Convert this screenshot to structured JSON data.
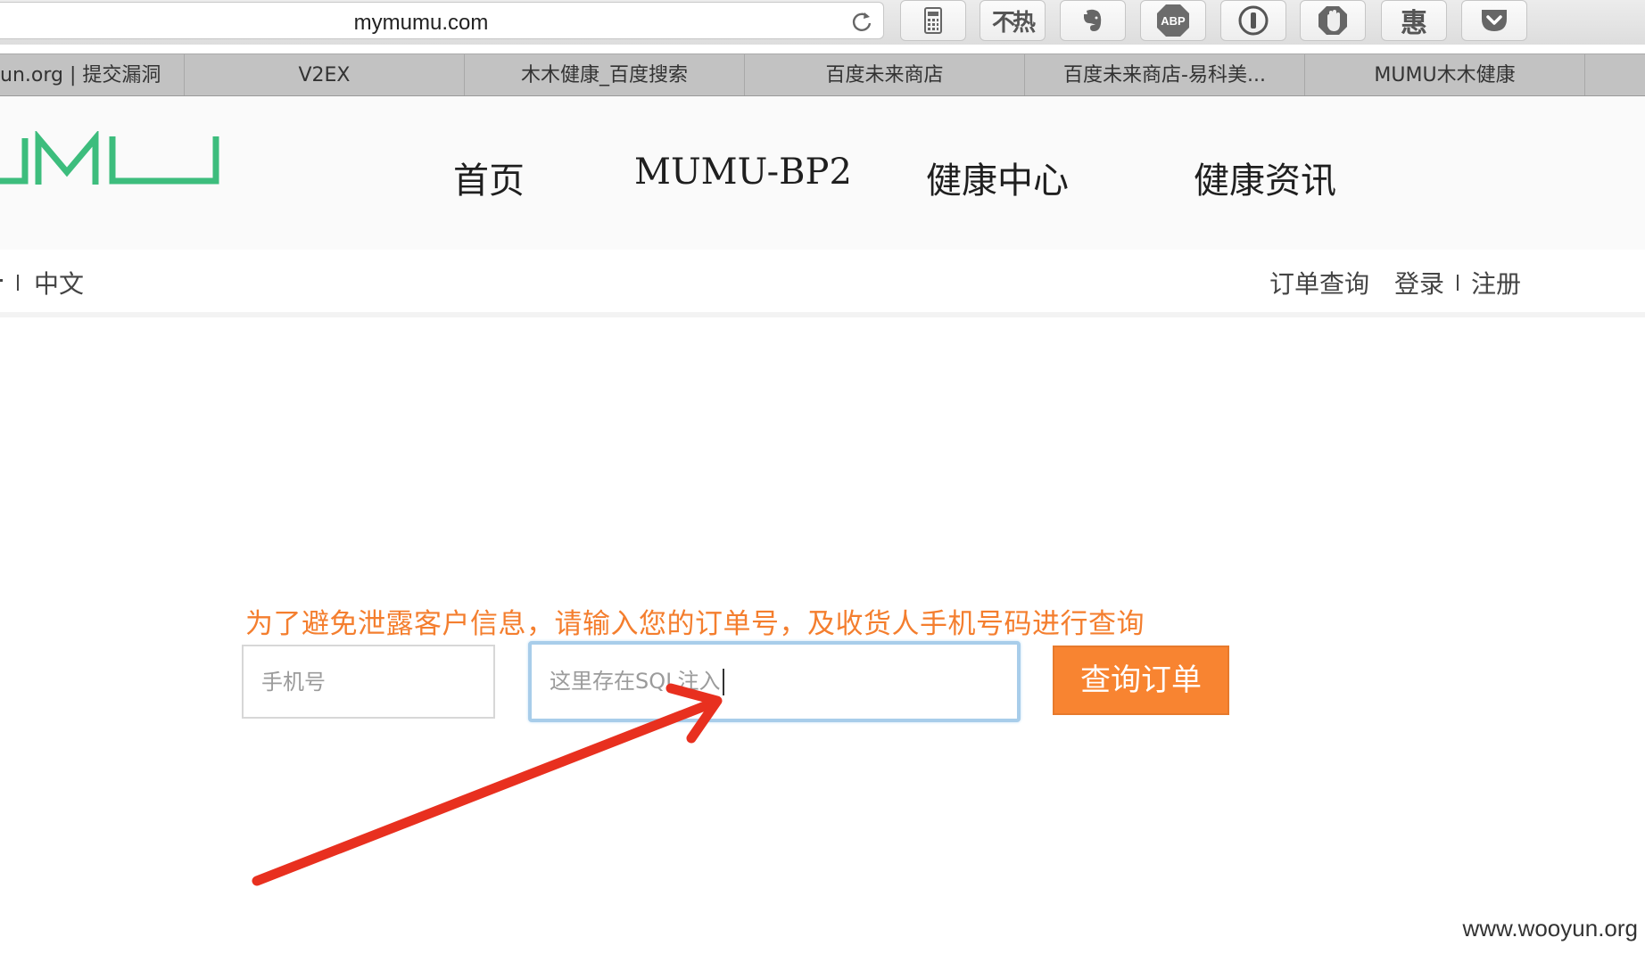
{
  "browser": {
    "url": "mymumu.com",
    "extensions": [
      {
        "name": "calculator-icon"
      },
      {
        "name": "hot-off-icon",
        "label": "不热"
      },
      {
        "name": "evernote-icon"
      },
      {
        "name": "adblock-plus-icon",
        "label": "ABP"
      },
      {
        "name": "onepassword-icon"
      },
      {
        "name": "stop-hand-icon"
      },
      {
        "name": "hui-icon",
        "label": "惠"
      },
      {
        "name": "pocket-icon"
      }
    ],
    "bookmarks": [
      "un.org | 提交漏洞",
      "V2EX",
      "木木健康_百度搜索",
      "百度未来商店",
      "百度未来商店-易科美...",
      "MUMU木木健康"
    ]
  },
  "site": {
    "logo_text": "MUMU",
    "nav": [
      "首页",
      "MUMU-BP2",
      "健康中心",
      "健康资讯"
    ],
    "lang_separator": "I",
    "lang": "中文",
    "user_links": {
      "orders": "订单查询",
      "login": "登录",
      "separator": "I",
      "register": "注册"
    }
  },
  "query_form": {
    "hint": "为了避免泄露客户信息，请输入您的订单号，及收货人手机号码进行查询",
    "phone_placeholder": "手机号",
    "order_value": "这里存在SQL注入",
    "submit_label": "查询订单"
  },
  "colors": {
    "accent_orange": "#f88431",
    "hint_orange": "#f47e2e",
    "logo_green": "#3dbd7d",
    "annotation_red": "#e8301f"
  },
  "watermark": "www.wooyun.org"
}
